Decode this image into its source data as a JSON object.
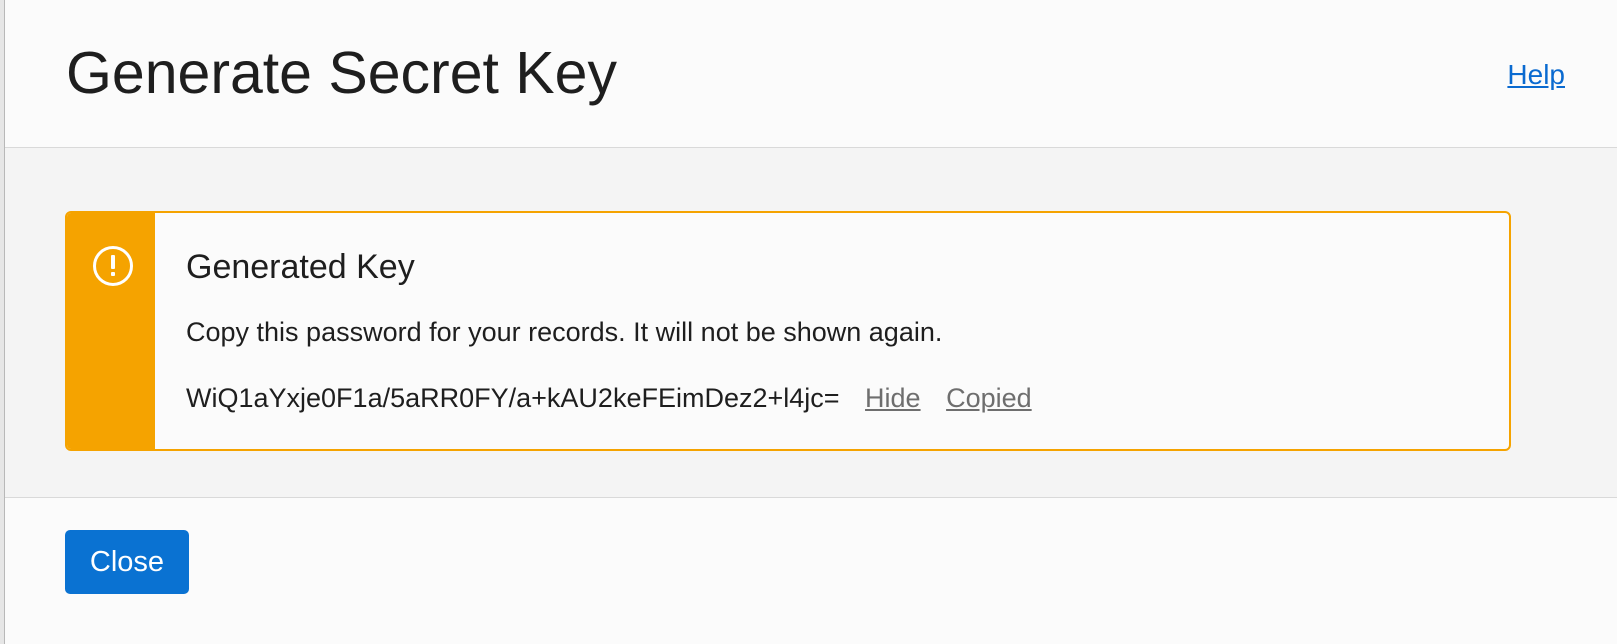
{
  "dialog": {
    "title": "Generate Secret Key",
    "help_label": "Help"
  },
  "alert": {
    "icon": "alert-circle-icon",
    "accent_color": "#f5a300",
    "title": "Generated Key",
    "message": "Copy this password for your records. It will not be shown again.",
    "key_value": "WiQ1aYxje0F1a/5aRR0FY/a+kAU2keFEimDez2+l4jc=",
    "hide_label": "Hide",
    "copy_status_label": "Copied"
  },
  "footer": {
    "close_label": "Close",
    "close_color": "#0a72d2"
  }
}
